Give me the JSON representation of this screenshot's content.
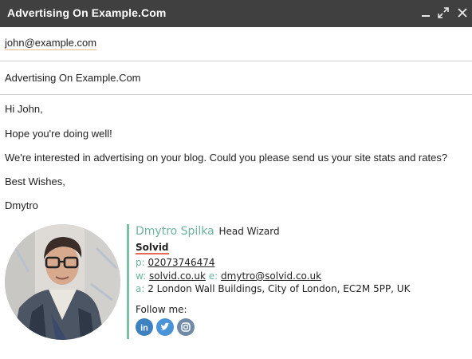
{
  "window": {
    "title": "Advertising On Example.Com",
    "controls": {
      "minimize_icon": "minimize-icon",
      "expand_icon": "expand-icon",
      "close_icon": "close-icon"
    }
  },
  "compose": {
    "to": "john@example.com",
    "subject": "Advertising On Example.Com"
  },
  "message": {
    "greeting": "Hi John,",
    "line1": "Hope you're doing well!",
    "line2": "We're interested in advertising on your blog. Could you please send us your site stats and rates?",
    "closing": "Best Wishes,",
    "sender": "Dmytro"
  },
  "signature": {
    "name": "Dmytro Spilka",
    "role": "Head Wizard",
    "company": "Solvid",
    "phone_label": "p:",
    "phone": "02073746474",
    "web_label": "w:",
    "website": "solvid.co.uk",
    "email_label": "e:",
    "email": "dmytro@solvid.co.uk",
    "address_label": "a:",
    "address": "2 London Wall Buildings, City of London, EC2M 5PP, UK",
    "follow_label": "Follow me:",
    "social": [
      {
        "icon": "linkedin-icon",
        "color": "#3d81c0"
      },
      {
        "icon": "twitter-icon",
        "color": "#4a93d8"
      },
      {
        "icon": "instagram-icon",
        "color": "#6f8aa6"
      }
    ],
    "accent_color": "#6bb49b"
  }
}
